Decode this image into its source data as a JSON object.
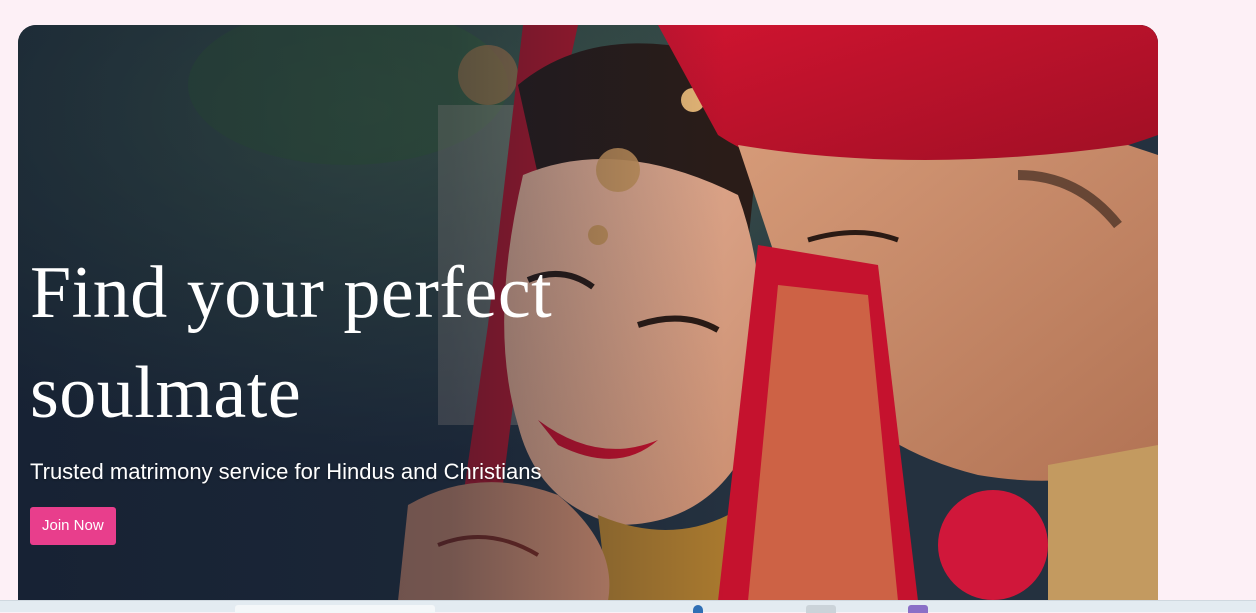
{
  "hero": {
    "title": "Find your perfect soulmate",
    "subtitle": "Trusted matrimony service for Hindus and Christians",
    "cta_label": "Join Now",
    "accent_color": "#e83e8c"
  },
  "icons": [
    "hero-couple-image-icon"
  ]
}
